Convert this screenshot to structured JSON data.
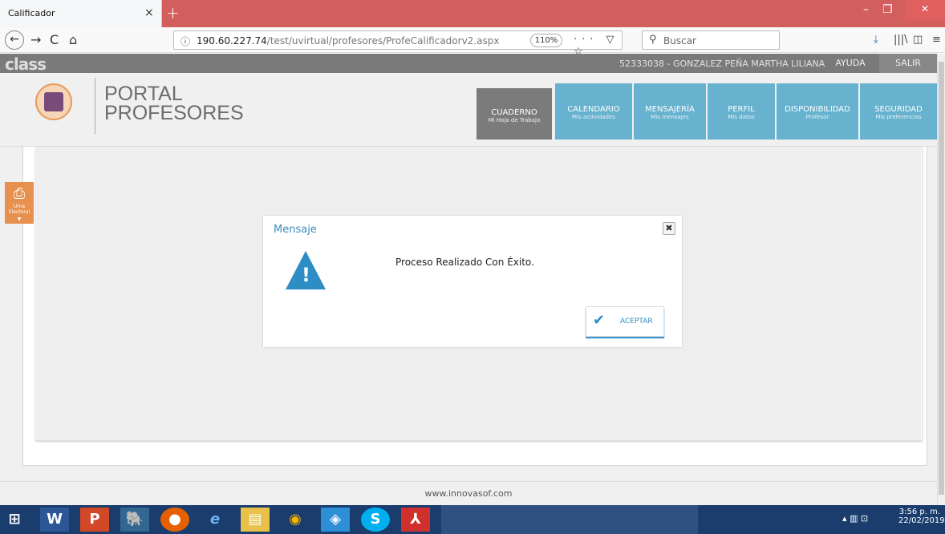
{
  "browser": {
    "tab_title": "Calificador",
    "tab_close": "×",
    "new_tab": "+",
    "url_host": "190.60.227.74",
    "url_path": "/test/uvirtual/profesores/ProfeCalificadorv2.aspx",
    "zoom": "110%",
    "search_placeholder": "Buscar",
    "back": "←",
    "forward": "→",
    "reload": "C",
    "home": "⌂",
    "page_actions": "··· ▽ ☆"
  },
  "site": {
    "logo": "class",
    "user": "52333038 - GONZALEZ PEÑA MARTHA LILIANA",
    "help": "AYUDA",
    "logout": "SALIR"
  },
  "portal": {
    "title_line1": "PORTAL",
    "title_line2": "PROFESORES",
    "menu": [
      {
        "label": "CUADERNO",
        "sub": "Mi Hoja de Trabajo"
      },
      {
        "label": "CALENDARIO",
        "sub": "Mis actividades"
      },
      {
        "label": "MENSAJERÍA",
        "sub": "Mis mensajes"
      },
      {
        "label": "PERFIL",
        "sub": "Mis datos"
      },
      {
        "label": "DISPONIBILIDAD",
        "sub": "Profesor"
      },
      {
        "label": "SEGURIDAD",
        "sub": "Mis preferencias"
      }
    ],
    "side_tab": "Urna Electoral"
  },
  "dialog": {
    "title": "Mensaje",
    "close": "✖",
    "message": "Proceso Realizado Con Éxito.",
    "accept": "ACEPTAR"
  },
  "footer": {
    "text": "www.innovasof.com"
  },
  "taskbar": {
    "time": "3:56 p. m.",
    "date": "22/02/2019"
  },
  "colors": {
    "tabbar": "#d35e5e",
    "menu_blue": "#67b2ce",
    "menu_gray": "#7b7b7b",
    "accent": "#2e8dc4"
  }
}
